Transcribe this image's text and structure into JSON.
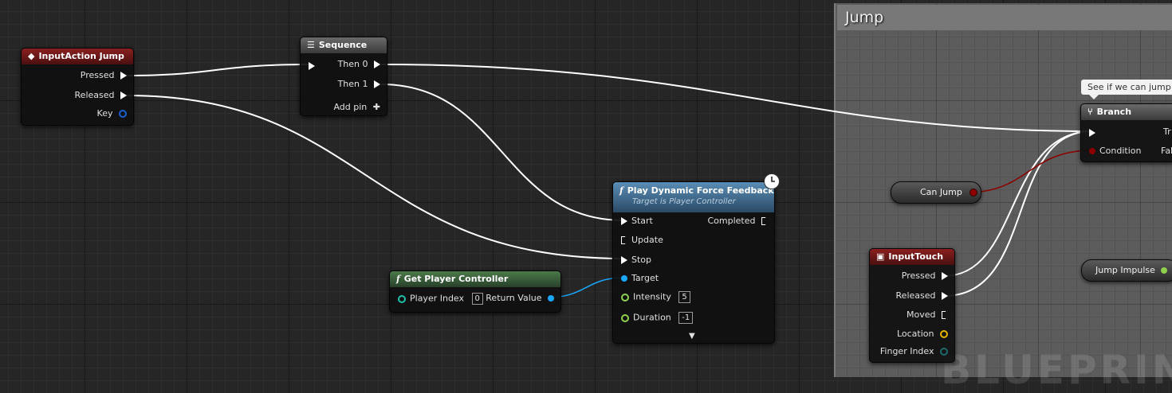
{
  "comment": {
    "title": "Jump"
  },
  "watermark": "BLUEPRINT",
  "tooltip": "See if we can jump",
  "nodes": {
    "inputaction_jump": {
      "title": "InputAction Jump",
      "pins": {
        "pressed": "Pressed",
        "released": "Released",
        "key": "Key"
      }
    },
    "sequence": {
      "title": "Sequence",
      "pins": {
        "then0": "Then 0",
        "then1": "Then 1",
        "add_pin": "Add pin"
      }
    },
    "force_feedback": {
      "title": "Play Dynamic Force Feedback",
      "subtitle": "Target is Player Controller",
      "pins": {
        "start": "Start",
        "update": "Update",
        "stop": "Stop",
        "target": "Target",
        "intensity": "Intensity",
        "duration": "Duration",
        "completed": "Completed"
      },
      "values": {
        "intensity": "5",
        "duration": "-1"
      }
    },
    "get_player_controller": {
      "title": "Get Player Controller",
      "pins": {
        "player_index": "Player Index",
        "return_value": "Return Value"
      },
      "values": {
        "player_index": "0"
      }
    },
    "branch": {
      "title": "Branch",
      "pins": {
        "condition": "Condition",
        "true_partial": "Tr",
        "false_partial": "Fal"
      }
    },
    "can_jump": {
      "label": "Can Jump"
    },
    "jump_impulse": {
      "label": "Jump Impulse"
    },
    "input_touch": {
      "title": "InputTouch",
      "pins": {
        "pressed": "Pressed",
        "released": "Released",
        "moved": "Moved",
        "location": "Location",
        "finger_index": "Finger Index"
      }
    }
  },
  "colors": {
    "exec": "#ffffff",
    "bool": "#8c0000",
    "object": "#1aa8ff",
    "float": "#8fd14f",
    "vector": "#e7b400",
    "int": "#1ec2a6",
    "key_struct": "#1a5fd6"
  },
  "icons": [
    "event-diamond-icon",
    "sequence-icon",
    "function-icon",
    "branch-icon",
    "latent-clock-icon",
    "input-touch-icon",
    "expand-arrow-icon",
    "add-icon"
  ]
}
